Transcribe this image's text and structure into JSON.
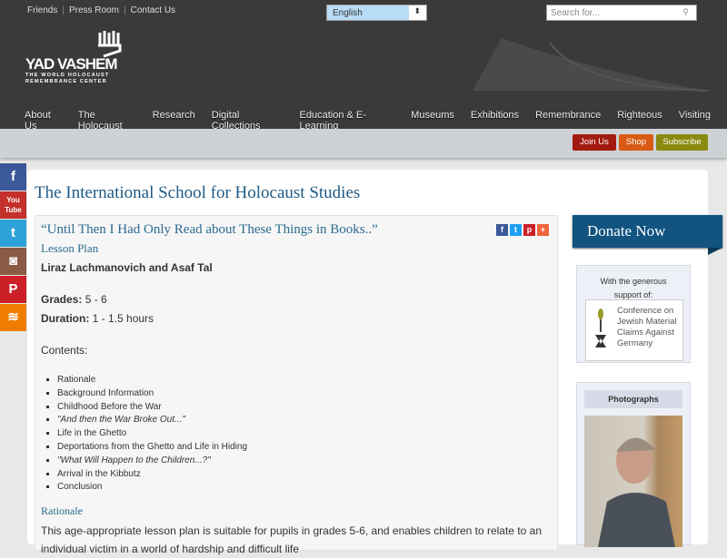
{
  "header": {
    "top_links": [
      "Friends",
      "Press Room",
      "Contact Us"
    ],
    "language": "English",
    "search_placeholder": "Search for...",
    "logo": {
      "hebrew": "יד ושם",
      "name": "YAD VASHEM",
      "sub1": "THE WORLD HOLOCAUST",
      "sub2": "REMEMBRANCE CENTER"
    }
  },
  "nav": [
    "About Us",
    "The Holocaust",
    "Research",
    "Digital Collections",
    "Education & E-Learning",
    "Museums",
    "Exhibitions",
    "Remembrance",
    "Righteous",
    "Visiting"
  ],
  "actions": {
    "join": "Join Us",
    "shop": "Shop",
    "subscribe": "Subscribe"
  },
  "social": [
    {
      "label": "f",
      "color": "#3b5998"
    },
    {
      "label": "You Tube",
      "color": "#c4302b"
    },
    {
      "label": "t",
      "color": "#2ea2d8"
    },
    {
      "label": "◙",
      "color": "#8a5a44"
    },
    {
      "label": "P",
      "color": "#cb2027"
    },
    {
      "label": "≋",
      "color": "#f07d00"
    }
  ],
  "page": {
    "title": "The International School for Holocaust Studies",
    "lesson_title": "“Until Then I Had Only Read about These Things in Books..”",
    "lesson_type": "Lesson Plan",
    "authors": "Liraz Lachmanovich and Asaf Tal",
    "grades_label": "Grades:",
    "grades": "5 - 6",
    "duration_label": "Duration:",
    "duration": "1 - 1.5 hours",
    "contents_label": "Contents:",
    "contents": [
      "Rationale",
      "Background Information",
      "Childhood Before the War",
      "\"And then the War Broke Out...\"",
      "Life in the Ghetto",
      "Deportations from the Ghetto and Life in Hiding",
      "\"What Will Happen to the Children...?\"",
      "Arrival in the Kibbutz",
      "Conclusion"
    ],
    "rationale_heading": "Rationale",
    "rationale_text": "This age-appropriate lesson plan is suitable for pupils in grades 5-6, and enables children to relate to an individual victim in a world of hardship and difficult life"
  },
  "share": [
    "f",
    "t",
    "p",
    "+"
  ],
  "sidebar": {
    "donate": "Donate Now",
    "support_line1": "With the generous",
    "support_line2": "support of:",
    "claims": [
      "Conference on",
      "Jewish Material",
      "Claims Against",
      "Germany"
    ],
    "photos_heading": "Photographs"
  }
}
